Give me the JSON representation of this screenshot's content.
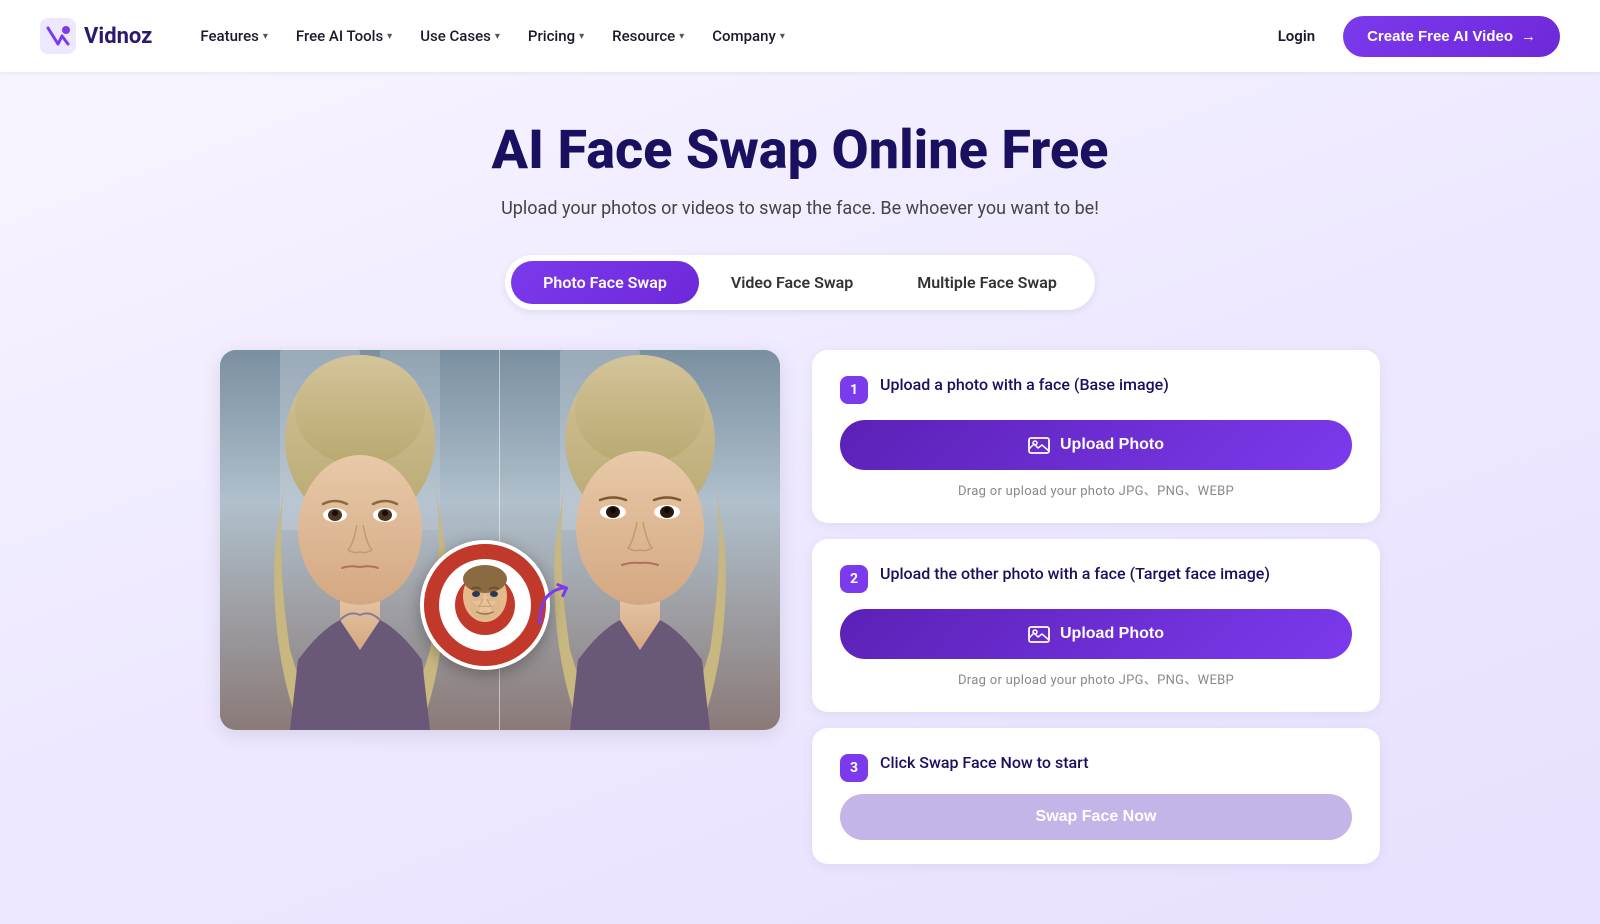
{
  "nav": {
    "logo_text": "Vidnoz",
    "items": [
      {
        "label": "Features",
        "has_chevron": true
      },
      {
        "label": "Free AI Tools",
        "has_chevron": true
      },
      {
        "label": "Use Cases",
        "has_chevron": true
      },
      {
        "label": "Pricing",
        "has_chevron": true
      },
      {
        "label": "Resource",
        "has_chevron": true
      },
      {
        "label": "Company",
        "has_chevron": true
      }
    ],
    "login_label": "Login",
    "cta_label": "Create Free AI Video",
    "cta_arrow": "→"
  },
  "hero": {
    "title": "AI Face Swap Online Free",
    "subtitle": "Upload your photos or videos to swap the face. Be whoever you want to be!"
  },
  "tabs": [
    {
      "label": "Photo Face Swap",
      "active": true,
      "id": "photo"
    },
    {
      "label": "Video Face Swap",
      "active": false,
      "id": "video"
    },
    {
      "label": "Multiple Face Swap",
      "active": false,
      "id": "multiple"
    }
  ],
  "steps": [
    {
      "number": "1",
      "title": "Upload a photo with a face (Base image)",
      "btn_label": "Upload Photo",
      "hint": "Drag or upload your photo  JPG、PNG、WEBP",
      "has_btn": true
    },
    {
      "number": "2",
      "title": "Upload the other photo with a face (Target face image)",
      "btn_label": "Upload Photo",
      "hint": "Drag or upload your photo  JPG、PNG、WEBP",
      "has_btn": true
    },
    {
      "number": "3",
      "title": "Click Swap Face Now to start",
      "btn_label": "Swap Face Now",
      "has_btn": true
    }
  ],
  "icons": {
    "upload": "🖼",
    "chevron": "▾",
    "arrow_right": "→"
  },
  "colors": {
    "brand": "#7c3aed",
    "dark_navy": "#1a1060",
    "bg_gradient_start": "#f8f4ff",
    "bg_gradient_end": "#e8e0ff"
  }
}
